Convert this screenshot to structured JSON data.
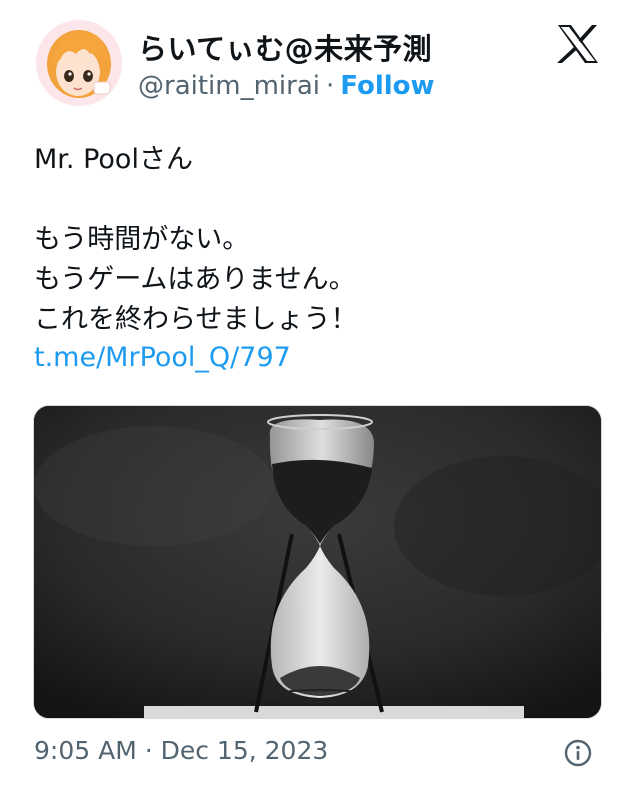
{
  "author": {
    "display_name": "らいてぃむ@未来予測",
    "handle": "@raitim_mirai",
    "separator": "·",
    "follow_label": "Follow"
  },
  "tweet": {
    "lines": [
      "Mr. Poolさん",
      "",
      "もう時間がない。",
      "もうゲームはありません。",
      "これを終わらせましょう！"
    ],
    "link": "t.me/MrPool_Q/797"
  },
  "media": {
    "icon": "hourglass-photo"
  },
  "footer": {
    "timestamp": "9:05 AM · Dec 15, 2023",
    "info_icon": "info-icon"
  },
  "brand": {
    "logo": "x-logo",
    "accent": "#1d9bf0",
    "text": "#0f1419",
    "muted": "#536471"
  }
}
